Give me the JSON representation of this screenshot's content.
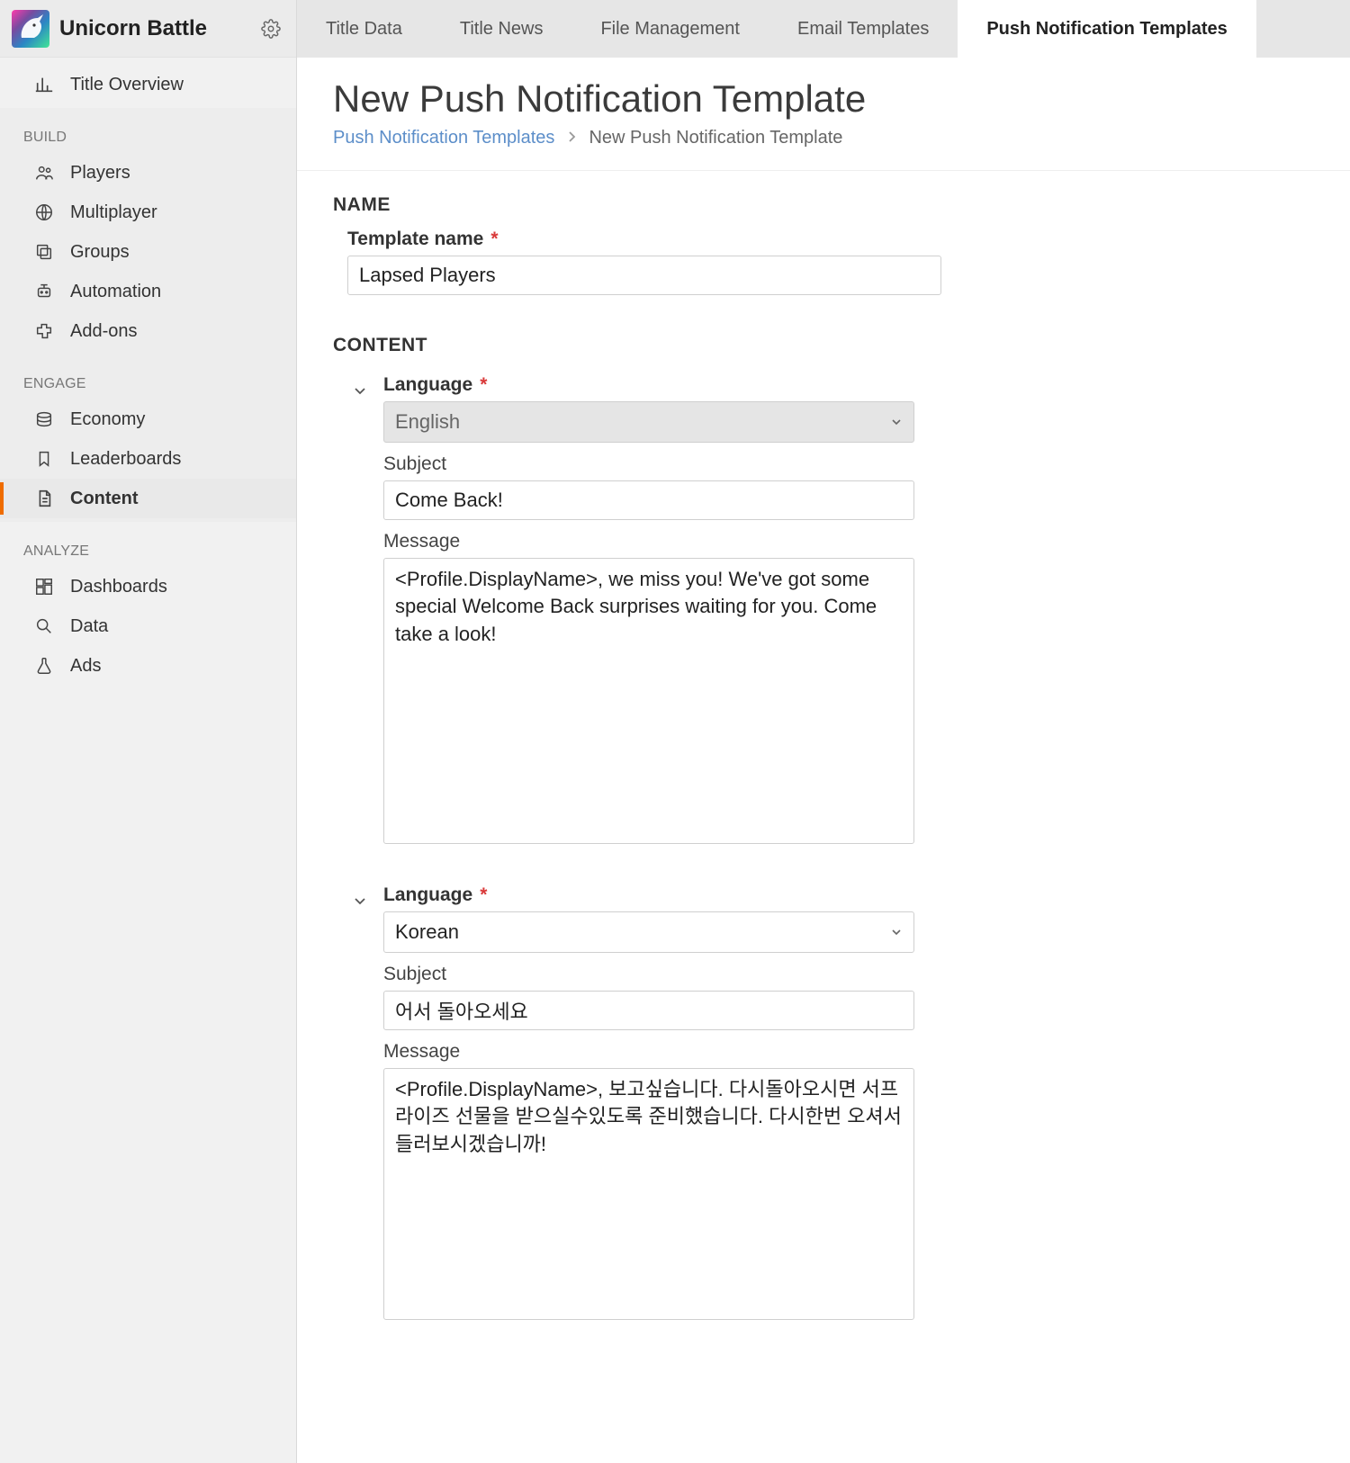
{
  "app": {
    "title": "Unicorn Battle"
  },
  "sidebar": {
    "overview_label": "Title Overview",
    "sections": {
      "build": {
        "title": "BUILD",
        "items": [
          {
            "label": "Players"
          },
          {
            "label": "Multiplayer"
          },
          {
            "label": "Groups"
          },
          {
            "label": "Automation"
          },
          {
            "label": "Add-ons"
          }
        ]
      },
      "engage": {
        "title": "ENGAGE",
        "items": [
          {
            "label": "Economy"
          },
          {
            "label": "Leaderboards"
          },
          {
            "label": "Content"
          }
        ]
      },
      "analyze": {
        "title": "ANALYZE",
        "items": [
          {
            "label": "Dashboards"
          },
          {
            "label": "Data"
          },
          {
            "label": "Ads"
          }
        ]
      }
    }
  },
  "tabs": [
    {
      "label": "Title Data"
    },
    {
      "label": "Title News"
    },
    {
      "label": "File Management"
    },
    {
      "label": "Email Templates"
    },
    {
      "label": "Push Notification Templates"
    }
  ],
  "page": {
    "title": "New Push Notification Template",
    "breadcrumb_parent": "Push Notification Templates",
    "breadcrumb_current": "New Push Notification Template"
  },
  "form": {
    "name_section": "NAME",
    "template_name_label": "Template name",
    "template_name_value": "Lapsed Players",
    "content_section": "CONTENT",
    "language_label": "Language",
    "subject_label": "Subject",
    "message_label": "Message",
    "blocks": [
      {
        "language": "English",
        "language_locked": true,
        "subject": "Come Back!",
        "message": "<Profile.DisplayName>, we miss you! We've got some special Welcome Back surprises waiting for you. Come take a look!"
      },
      {
        "language": "Korean",
        "language_locked": false,
        "subject": "어서 돌아오세요",
        "message": "<Profile.DisplayName>, 보고싶습니다. 다시돌아오시면 서프라이즈 선물을 받으실수있도록 준비했습니다. 다시한번 오셔서 들러보시겠습니까!"
      }
    ]
  }
}
